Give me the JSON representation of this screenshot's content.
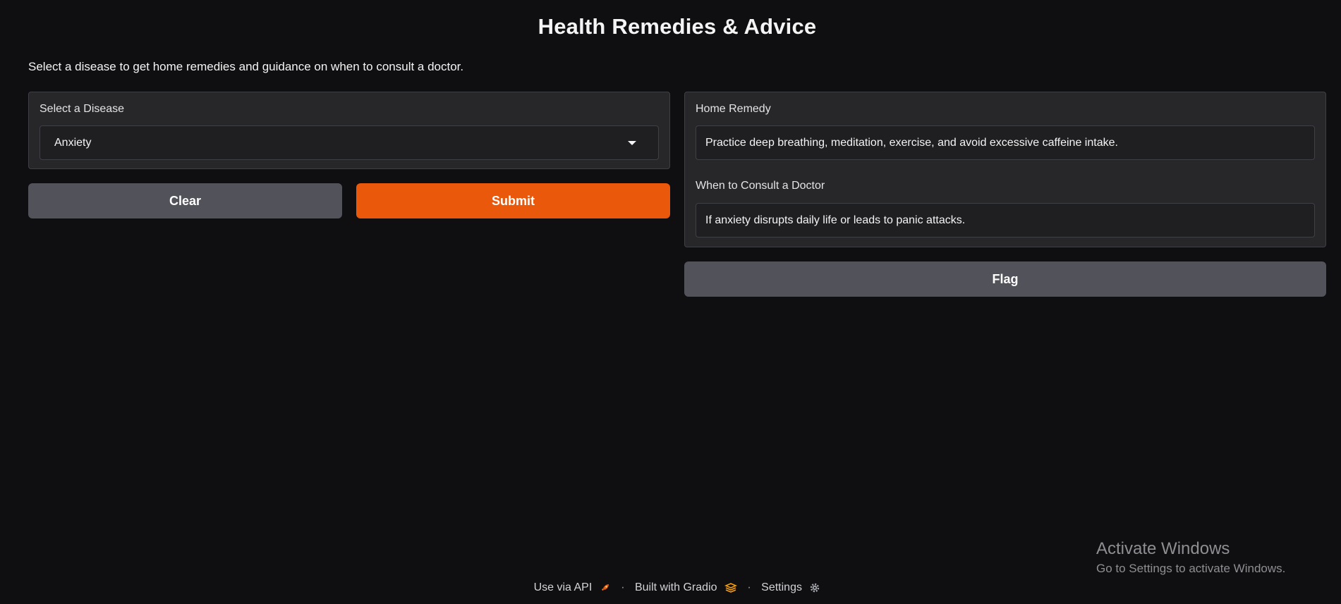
{
  "header": {
    "title": "Health Remedies & Advice",
    "description": "Select a disease to get home remedies and guidance on when to consult a doctor."
  },
  "input_panel": {
    "label": "Select a Disease",
    "selected_value": "Anxiety"
  },
  "buttons": {
    "clear": "Clear",
    "submit": "Submit",
    "flag": "Flag"
  },
  "output_panel": {
    "remedy_label": "Home Remedy",
    "remedy_value": "Practice deep breathing, meditation, exercise, and avoid excessive caffeine intake.",
    "doctor_label": "When to Consult a Doctor",
    "doctor_value": "If anxiety disrupts daily life or leads to panic attacks."
  },
  "footer": {
    "api": "Use via API",
    "built": "Built with Gradio",
    "settings": "Settings",
    "separator": "·"
  },
  "watermark": {
    "title": "Activate Windows",
    "subtitle": "Go to Settings to activate Windows."
  },
  "colors": {
    "background": "#0f0f11",
    "panel": "#27272a",
    "accent": "#ea580c",
    "secondary_button": "#52525b"
  }
}
